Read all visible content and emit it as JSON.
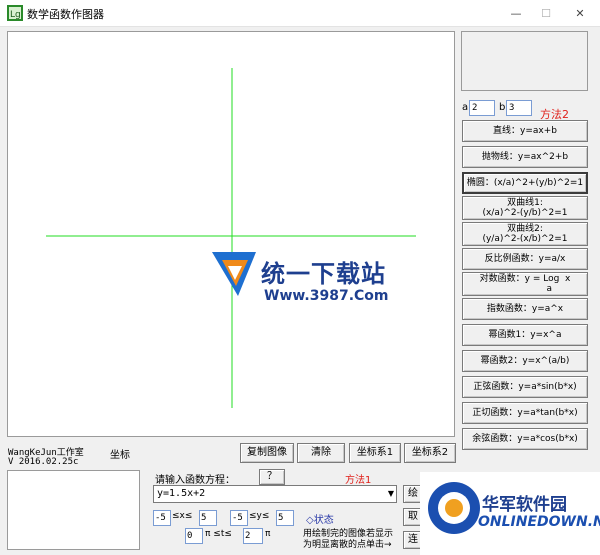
{
  "window": {
    "title": "数学函数作图器",
    "min": "—",
    "max": "☐",
    "close": "✕"
  },
  "params": {
    "a_label": "a",
    "a_value": "2",
    "b_label": "b",
    "b_value": "3",
    "method2": "方法2"
  },
  "functions": [
    "直线：y=ax+b",
    "抛物线：y=ax^2+b",
    "椭圆：(x/a)^2+(y/b)^2=1",
    "双曲线1:\n(x/a)^2-(y/b)^2=1",
    "双曲线2:\n(y/a)^2-(x/b)^2=1",
    "反比例函数：y=a/x",
    "对数函数：y = Log  x\n                 a",
    "指数函数：y=a^x",
    "幂函数1：y=x^a",
    "幂函数2：y=x^(a/b)",
    "正弦函数：y=a*sin(b*x)",
    "正切函数：y=a*tan(b*x)",
    "余弦函数：y=a*cos(b*x)"
  ],
  "footer": {
    "studio": "WangKeJun工作室",
    "version": "V 2016.02.25c",
    "coord_label": "坐标",
    "copy_button": "复制图像",
    "clear_button": "清除",
    "coord1_button": "坐标系1",
    "coord2_button": "坐标系2",
    "prompt": "请输入函数方程：",
    "help_button": "？",
    "method1": "方法1",
    "equation": "y=1.5x+2",
    "draw_button": "绘",
    "cancel_button": "取",
    "connect_button": "连",
    "x_min": "-5",
    "x_rel": "≤x≤",
    "x_max": "5",
    "y_min": "-5",
    "y_rel": "≤y≤",
    "y_max": "5",
    "status": "◇状态",
    "t_min": "0",
    "t_rel": "π ≤t≤",
    "t_max": "2",
    "t_unit": "π",
    "hint_line1": "用绘制完的图像若显示",
    "hint_line2": "为明显离散的点单击→"
  },
  "watermark": {
    "text1": "统一下载站",
    "text2": "Www.3987.Com",
    "text3": "华军软件园",
    "text4": "ONLINEDOWN.NET"
  },
  "colors": {
    "axis": "#22dd22",
    "accent_red": "#e0201a",
    "watermark_blue": "#1e3f8f"
  }
}
